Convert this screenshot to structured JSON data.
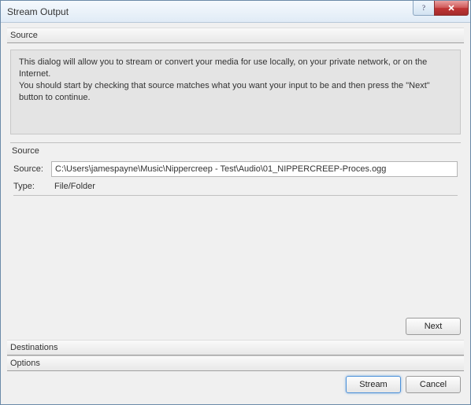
{
  "window": {
    "title": "Stream Output"
  },
  "titlebar_buttons": {
    "help_tooltip": "Help",
    "close_tooltip": "Close"
  },
  "sections": {
    "source_header": "Source",
    "destinations_header": "Destinations",
    "options_header": "Options"
  },
  "info": {
    "line1": "This dialog will allow you to stream or convert your media for use locally, on your private network, or on the Internet.",
    "line2": "You should start by checking that source matches what you want your input to be and then press the \"Next\" button to continue."
  },
  "source_group": {
    "group_label": "Source",
    "source_label": "Source:",
    "source_value": "C:\\Users\\jamespayne\\Music\\Nippercreep - Test\\Audio\\01_NIPPERCREEP-Proces.ogg",
    "type_label": "Type:",
    "type_value": "File/Folder"
  },
  "buttons": {
    "next": "Next",
    "stream": "Stream",
    "cancel": "Cancel"
  }
}
